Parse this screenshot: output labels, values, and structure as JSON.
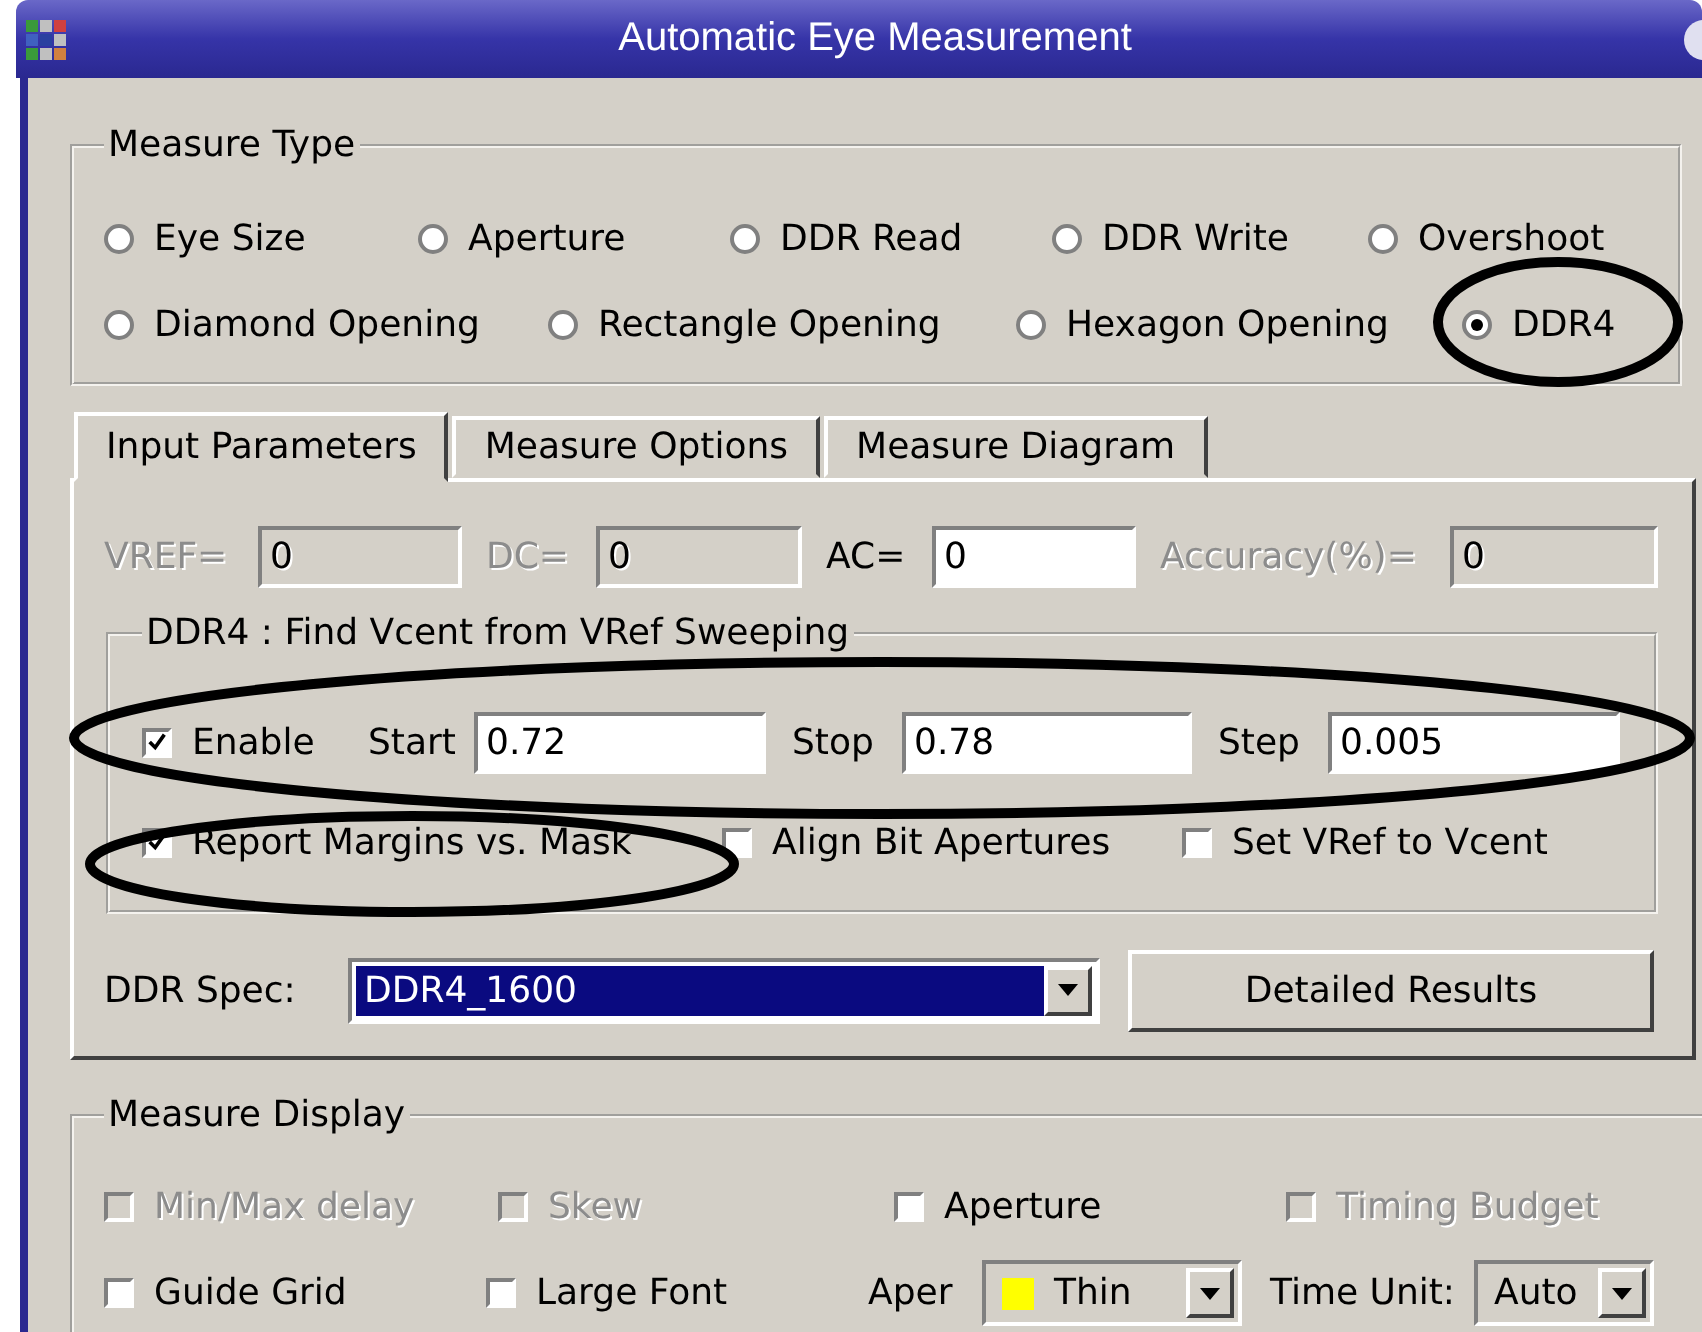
{
  "window": {
    "title": "Automatic Eye Measurement"
  },
  "measure_type": {
    "label": "Measure Type",
    "options": [
      {
        "label": "Eye Size",
        "selected": false
      },
      {
        "label": "Aperture",
        "selected": false
      },
      {
        "label": "DDR Read",
        "selected": false
      },
      {
        "label": "DDR Write",
        "selected": false
      },
      {
        "label": "Overshoot",
        "selected": false
      },
      {
        "label": "Diamond Opening",
        "selected": false
      },
      {
        "label": "Rectangle Opening",
        "selected": false
      },
      {
        "label": "Hexagon Opening",
        "selected": false
      },
      {
        "label": "DDR4",
        "selected": true
      }
    ]
  },
  "tabs": [
    {
      "label": "Input Parameters",
      "selected": true
    },
    {
      "label": "Measure Options",
      "selected": false
    },
    {
      "label": "Measure Diagram",
      "selected": false
    }
  ],
  "params": [
    {
      "label": "VREF=",
      "value": "0",
      "disabled": true
    },
    {
      "label": "DC=",
      "value": "0",
      "disabled": true
    },
    {
      "label": "AC=",
      "value": "0",
      "disabled": false
    },
    {
      "label": "Accuracy(%)=",
      "value": "0",
      "disabled": true
    }
  ],
  "sweep": {
    "label": "DDR4 : Find Vcent from VRef Sweeping",
    "enable": {
      "label": "Enable",
      "checked": true
    },
    "fields": [
      {
        "label": "Start",
        "value": "0.72"
      },
      {
        "label": "Stop",
        "value": "0.78"
      },
      {
        "label": "Step",
        "value": "0.005"
      }
    ],
    "options": [
      {
        "label": "Report Margins vs. Mask",
        "checked": true
      },
      {
        "label": "Align Bit Apertures",
        "checked": false
      },
      {
        "label": "Set VRef to Vcent",
        "checked": false
      }
    ]
  },
  "ddr_spec": {
    "label": "DDR Spec:",
    "value": "DDR4_1600"
  },
  "detailed_button": "Detailed Results",
  "measure_display": {
    "label": "Measure Display",
    "items": [
      {
        "kind": "checkbox",
        "label": "Min/Max delay",
        "checked": false,
        "disabled": true
      },
      {
        "kind": "checkbox",
        "label": "Skew",
        "checked": false,
        "disabled": true
      },
      {
        "kind": "checkbox",
        "label": "Aperture",
        "checked": false,
        "disabled": false
      },
      {
        "kind": "checkbox",
        "label": "Timing Budget",
        "checked": false,
        "disabled": true
      },
      {
        "kind": "checkbox",
        "label": "Guide Grid",
        "checked": false,
        "disabled": false
      },
      {
        "kind": "checkbox",
        "label": "Large Font",
        "checked": false,
        "disabled": false
      },
      {
        "kind": "select",
        "label": "Aper",
        "value": "Thin",
        "color": "#ffff00"
      },
      {
        "kind": "select",
        "label": "Time Unit:",
        "value": "Auto"
      }
    ]
  }
}
